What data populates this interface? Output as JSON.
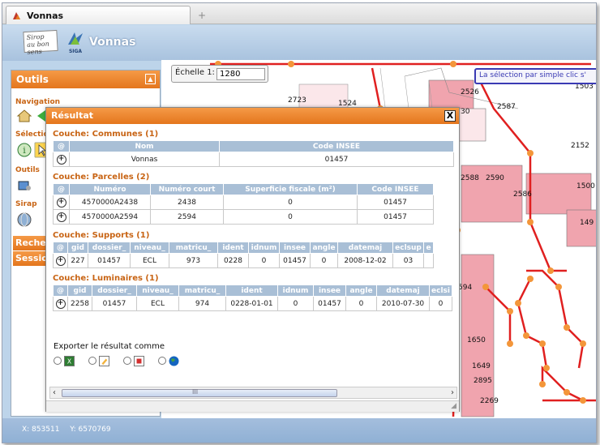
{
  "tab": {
    "title": "Vonnas",
    "new_tab": "+"
  },
  "header": {
    "logo_text": "Sirop au bon sens",
    "logo2_text": "SIGA",
    "app_title": "Vonnas"
  },
  "left_panel": {
    "title": "Outils",
    "navigation_label": "Navigation",
    "selection_label": "Sélection",
    "outils_label": "Outils",
    "sirap_label": "Sirap",
    "recherche_label": "Reche",
    "session_label": "Sessio"
  },
  "map": {
    "scale_label": "Échelle 1:",
    "scale_value": "1280",
    "tooltip": "La sélection par simple clic s'",
    "parcel_labels": [
      "2723",
      "1524",
      "2526",
      "30",
      "2587",
      "1503",
      "2152",
      "2588",
      "2590",
      "2586",
      "1500",
      "149",
      "594",
      "1650",
      "1649",
      "2895",
      "2269"
    ]
  },
  "dialog": {
    "title": "Résultat",
    "close": "X",
    "communes": {
      "heading": "Couche: Communes (1)",
      "columns": [
        "@",
        "Nom",
        "Code INSEE"
      ],
      "rows": [
        [
          "Vonnas",
          "01457"
        ]
      ]
    },
    "parcelles": {
      "heading": "Couche: Parcelles (2)",
      "columns": [
        "@",
        "Numéro",
        "Numéro court",
        "Superficie fiscale (m²)",
        "Code INSEE"
      ],
      "rows": [
        [
          "4570000A2438",
          "2438",
          "0",
          "01457"
        ],
        [
          "4570000A2594",
          "2594",
          "0",
          "01457"
        ]
      ]
    },
    "supports": {
      "heading": "Couche: Supports (1)",
      "columns": [
        "@",
        "gid",
        "dossier_",
        "niveau_",
        "matricu_",
        "ident",
        "idnum",
        "insee",
        "angle",
        "datemaj",
        "eclsup",
        "e"
      ],
      "rows": [
        [
          "227",
          "01457",
          "ECL",
          "973",
          "0228",
          "0",
          "01457",
          "0",
          "2008-12-02",
          "03",
          ""
        ]
      ]
    },
    "luminaires": {
      "heading": "Couche: Luminaires (1)",
      "columns": [
        "@",
        "gid",
        "dossier_",
        "niveau_",
        "matricu_",
        "ident",
        "idnum",
        "insee",
        "angle",
        "datemaj",
        "eclsi"
      ],
      "rows": [
        [
          "2258",
          "01457",
          "ECL",
          "974",
          "0228-01-01",
          "0",
          "01457",
          "0",
          "2010-07-30",
          "0"
        ]
      ]
    },
    "export_label": "Exporter le résultat comme",
    "scroll_mid": "III"
  },
  "status": {
    "x": "X: 853511",
    "y": "Y: 6570769"
  }
}
